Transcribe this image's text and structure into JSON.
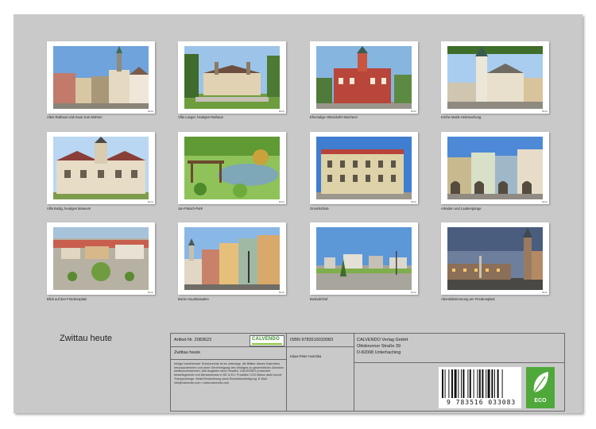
{
  "photo_name": "Motiv",
  "cards": [
    {
      "caption": "Altes Rathaus und Haus zum Mohren",
      "scene": "town"
    },
    {
      "caption": "Villa Langer, heutiges Rathaus",
      "scene": "villa"
    },
    {
      "caption": "Ehemalige Ottendorfer Bücherei",
      "scene": "library"
    },
    {
      "caption": "Kirche Mariä Heimsuchung",
      "scene": "church"
    },
    {
      "caption": "Villa Bodig, heutiges Museum",
      "scene": "museum"
    },
    {
      "caption": "Jan-Palach-Park",
      "scene": "park"
    },
    {
      "caption": "Grundschule",
      "scene": "school"
    },
    {
      "caption": "Arkaden und Laubengänge",
      "scene": "arcade"
    },
    {
      "caption": "Blick auf den Friedensplatz",
      "scene": "square"
    },
    {
      "caption": "Bunte Hausfassaden",
      "scene": "facades"
    },
    {
      "caption": "Busbahnhof",
      "scene": "bus"
    },
    {
      "caption": "Abenddämmerung am Friedensplatz",
      "scene": "dusk"
    }
  ],
  "title": "Zwittau heute",
  "info": {
    "article": "Artikel-Nr. 2083623",
    "logo": "CALVENDO",
    "title": "Zwittau heute",
    "notice": "Infolge bestehender Schutzrechte ist es untersagt, die Blätter dieses Kalenders herauszutrennen und ohne Genehmigung des Verlages zu gewerblichen Zwecken weiterzuverwenden. Alle Angaben ohne Gewähr. CALVENDO produziert bedarfsgerecht und klimabewusst in DE & EU. Prodotto/ CO2-Bilanz dank kurzer Transportwege. Abfall-Reduzierung dank Einzelstückfertigung. E-Mail: info@calvendo.com • www.calvendo.com",
    "isbn": "ISBN 9783516033083",
    "author": "Klaus-Peter Huschka",
    "publisher": "CALVENDO Verlag GmbH",
    "street": "Ottobrunner Straße 39",
    "city": "D-82008 Unterhaching",
    "barcode_number": "9 783516 033083",
    "eco": "ECO"
  },
  "colors": {
    "sheet": "#c9c9c9",
    "eco": "#4fa83a",
    "logo_green": "#3a8a2e"
  }
}
